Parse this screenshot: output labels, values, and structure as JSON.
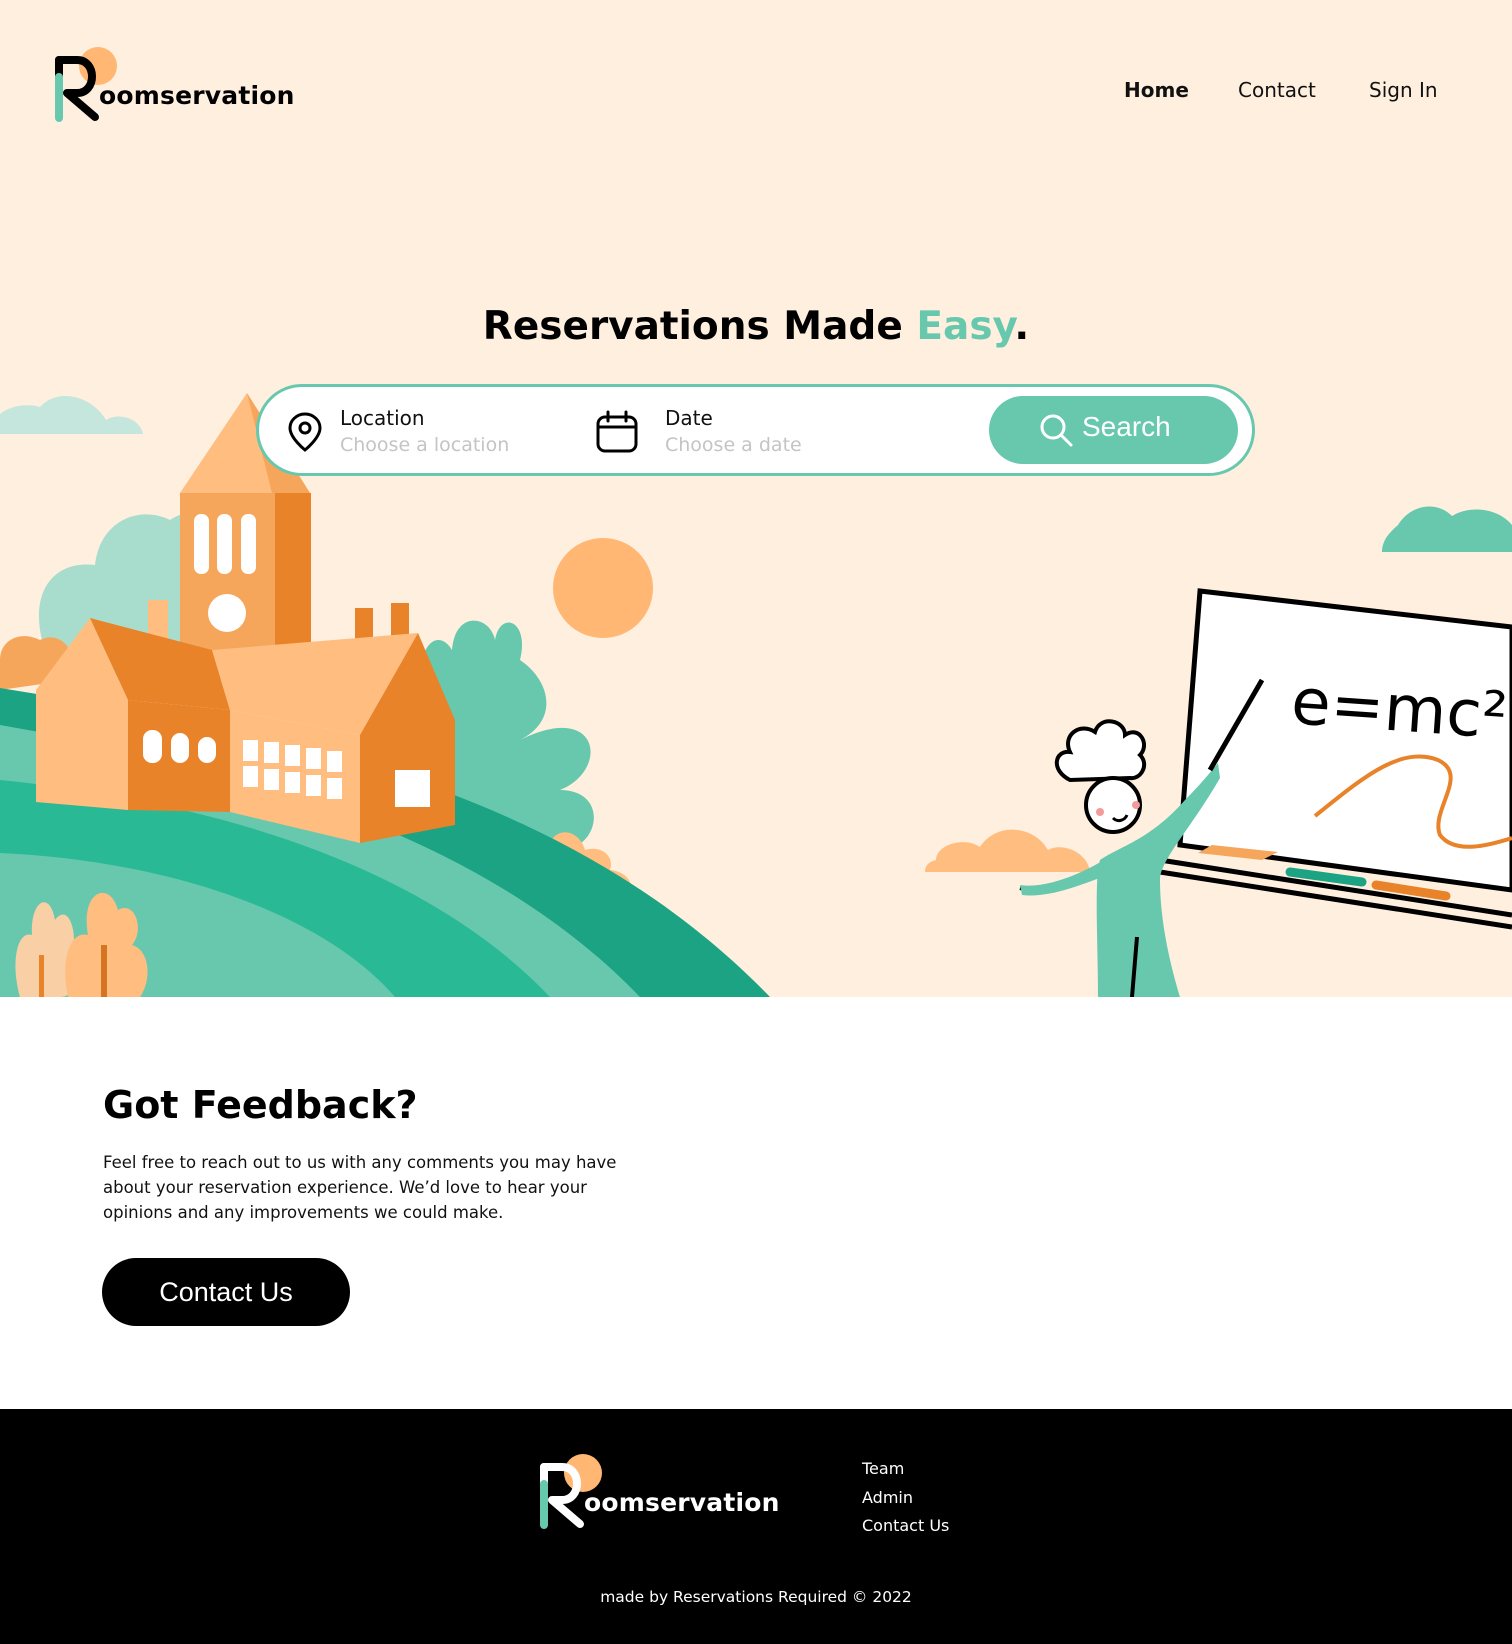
{
  "brand": {
    "name": "oomservation",
    "initial": "R"
  },
  "nav": {
    "items": [
      "Home",
      "Contact",
      "Sign In"
    ],
    "active": "Home"
  },
  "hero": {
    "title_main": "Reservations Made ",
    "title_accent": "Easy",
    "title_end": ".",
    "illustration_text": "e=mc²"
  },
  "search": {
    "location": {
      "label": "Location",
      "placeholder": "Choose a location",
      "icon": "map-pin-icon"
    },
    "date": {
      "label": "Date",
      "placeholder": "Choose a date",
      "icon": "calendar-icon"
    },
    "button_label": "Search",
    "button_icon": "search-icon"
  },
  "feedback": {
    "title": "Got Feedback?",
    "body": "Feel free to reach out to us with any comments you may have about your reservation experience. We’d love to hear your opinions and any improvements we could make.",
    "button_label": "Contact Us"
  },
  "footer": {
    "links": [
      "Team",
      "Admin",
      "Contact Us"
    ],
    "copyright": "made by Reservations Required © 2022"
  },
  "colors": {
    "accent": "#67c8ae",
    "hero_bg": "#ffefdf",
    "orange": "#e8832a",
    "peach": "#ffbd80",
    "dark_green": "#1ba383"
  }
}
